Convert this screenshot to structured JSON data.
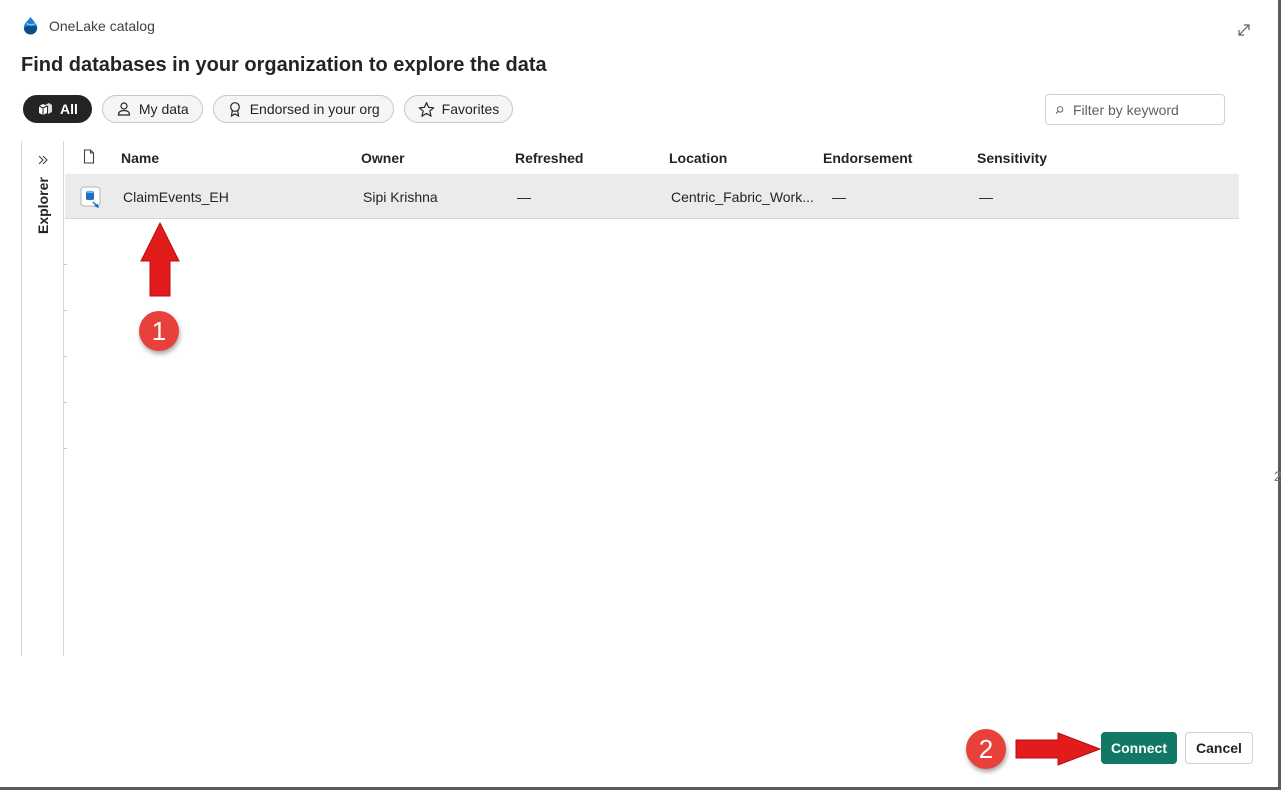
{
  "app": {
    "title": "OneLake catalog"
  },
  "page": {
    "heading": "Find databases in your organization to explore the data"
  },
  "filters": [
    {
      "label": "All",
      "icon": "cube-stack-icon",
      "active": true
    },
    {
      "label": "My data",
      "icon": "person-icon",
      "active": false
    },
    {
      "label": "Endorsed in your org",
      "icon": "ribbon-icon",
      "active": false
    },
    {
      "label": "Favorites",
      "icon": "star-icon",
      "active": false
    }
  ],
  "search": {
    "placeholder": "Filter by keyword",
    "value": ""
  },
  "explorer": {
    "label": "Explorer"
  },
  "table": {
    "columns": [
      "Name",
      "Owner",
      "Refreshed",
      "Location",
      "Endorsement",
      "Sensitivity"
    ],
    "rows": [
      {
        "name": "ClaimEvents_EH",
        "owner": "Sipi Krishna",
        "refreshed": "—",
        "location": "Centric_Fabric_Work...",
        "endorsement": "—",
        "sensitivity": "—"
      }
    ]
  },
  "annotations": {
    "step1": "1",
    "step2": "2"
  },
  "actions": {
    "connect": "Connect",
    "cancel": "Cancel"
  },
  "colors": {
    "primary": "#117865",
    "annotation": "#e8413c",
    "selected_row": "#ebebeb",
    "active_pill": "#242424"
  }
}
